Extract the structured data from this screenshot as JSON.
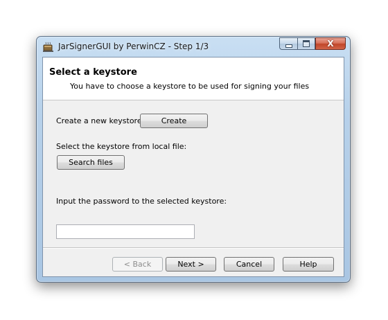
{
  "window": {
    "title": "JarSignerGUI by PerwinCZ - Step 1/3",
    "icon": "java-cup-icon"
  },
  "header": {
    "title": "Select a keystore",
    "subtitle": "You have to choose a keystore to be used for signing your files"
  },
  "create": {
    "label": "Create a new keystore:",
    "button": "Create"
  },
  "select_file": {
    "label": "Select the keystore from local file:",
    "button": "Search files"
  },
  "password": {
    "label": "Input the password to the selected keystore:",
    "value": "",
    "placeholder": ""
  },
  "footer": {
    "back": "< Back",
    "next": "Next >",
    "cancel": "Cancel",
    "help": "Help"
  },
  "caption_buttons": {
    "close_glyph": "X"
  }
}
